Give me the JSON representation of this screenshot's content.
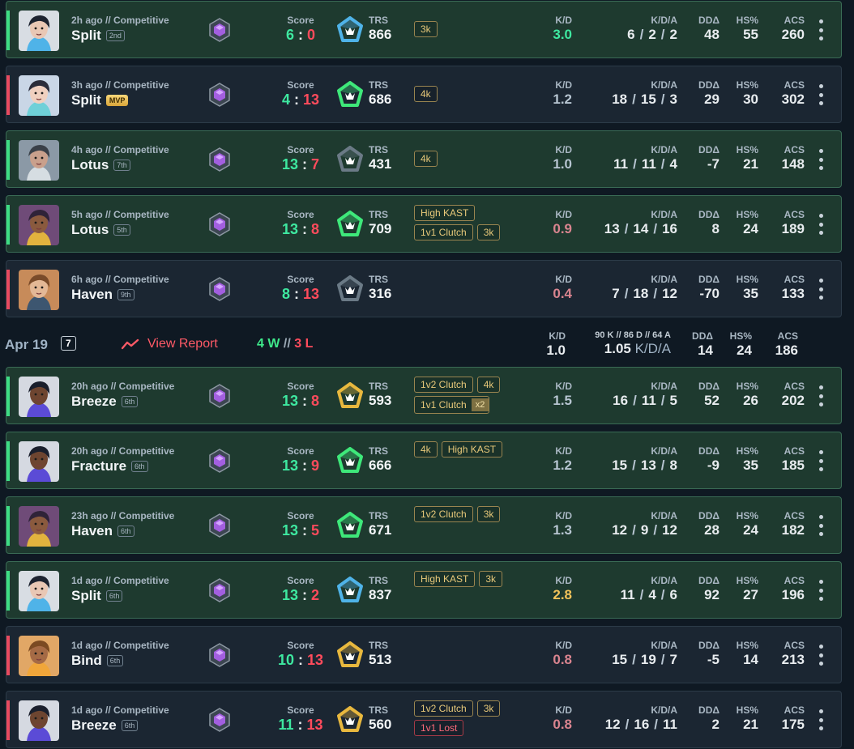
{
  "colors": {
    "win_accent": "#3ddc84",
    "loss_accent": "#e84a5f",
    "win_bg": "#1e3a2f",
    "loss_bg": "#1b2632",
    "page_bg": "#0f1923"
  },
  "labels": {
    "score": "Score",
    "trs": "TRS",
    "kd": "K/D",
    "kda": "K/D/A",
    "dd": "DDΔ",
    "hs": "HS%",
    "acs": "ACS",
    "colon": ":",
    "slash": "/"
  },
  "matches": [
    {
      "result": "win",
      "ago": "2h ago // Competitive",
      "map": "Split",
      "place": "2nd",
      "mvp": false,
      "score_team": "6",
      "score_enemy": "0",
      "trs": "866",
      "trs_color": "#4fb3e8",
      "badges": [
        "3k"
      ],
      "badge_style": [
        "gold"
      ],
      "kd": "3.0",
      "kd_tone": "green",
      "k": "6",
      "d": "2",
      "a": "2",
      "dd": "48",
      "hs": "55",
      "acs": "260",
      "agent": "jett"
    },
    {
      "result": "loss",
      "ago": "3h ago // Competitive",
      "map": "Split",
      "place": "MVP",
      "mvp": true,
      "score_team": "4",
      "score_enemy": "13",
      "trs": "686",
      "trs_color": "#3ee87a",
      "badges": [
        "4k"
      ],
      "badge_style": [
        "gold"
      ],
      "kd": "1.2",
      "kd_tone": "dim",
      "k": "18",
      "d": "15",
      "a": "3",
      "dd": "29",
      "hs": "30",
      "acs": "302",
      "agent": "sage"
    },
    {
      "result": "win",
      "ago": "4h ago // Competitive",
      "map": "Lotus",
      "place": "7th",
      "mvp": false,
      "score_team": "13",
      "score_enemy": "7",
      "trs": "431",
      "trs_color": "#6b7a86",
      "badges": [
        "4k"
      ],
      "badge_style": [
        "gold"
      ],
      "kd": "1.0",
      "kd_tone": "dim",
      "k": "11",
      "d": "11",
      "a": "4",
      "dd": "-7",
      "hs": "21",
      "acs": "148",
      "agent": "cypher"
    },
    {
      "result": "win",
      "ago": "5h ago // Competitive",
      "map": "Lotus",
      "place": "5th",
      "mvp": false,
      "score_team": "13",
      "score_enemy": "8",
      "trs": "709",
      "trs_color": "#3ee87a",
      "badges": [
        "High KAST",
        "1v1 Clutch",
        "3k"
      ],
      "badge_style": [
        "gold",
        "gold",
        "gold"
      ],
      "kd": "0.9",
      "kd_tone": "pink",
      "k": "13",
      "d": "14",
      "a": "16",
      "dd": "8",
      "hs": "24",
      "acs": "189",
      "agent": "astra"
    },
    {
      "result": "loss",
      "ago": "6h ago // Competitive",
      "map": "Haven",
      "place": "9th",
      "mvp": false,
      "score_team": "8",
      "score_enemy": "13",
      "trs": "316",
      "trs_color": "#6b7a86",
      "badges": [],
      "badge_style": [],
      "kd": "0.4",
      "kd_tone": "pink",
      "k": "7",
      "d": "18",
      "a": "12",
      "dd": "-70",
      "hs": "35",
      "acs": "133",
      "agent": "sova"
    },
    {
      "result": "win",
      "ago": "20h ago // Competitive",
      "map": "Breeze",
      "place": "6th",
      "mvp": false,
      "score_team": "13",
      "score_enemy": "8",
      "trs": "593",
      "trs_color": "#e8b83e",
      "badges": [
        "1v2 Clutch",
        "4k",
        "1v1 Clutch"
      ],
      "badge_style": [
        "gold",
        "gold",
        "gold"
      ],
      "badge_x2": "x2",
      "kd": "1.5",
      "kd_tone": "dim",
      "k": "16",
      "d": "11",
      "a": "5",
      "dd": "52",
      "hs": "26",
      "acs": "202",
      "agent": "neon"
    },
    {
      "result": "win",
      "ago": "20h ago // Competitive",
      "map": "Fracture",
      "place": "6th",
      "mvp": false,
      "score_team": "13",
      "score_enemy": "9",
      "trs": "666",
      "trs_color": "#3ee87a",
      "badges": [
        "4k",
        "High KAST"
      ],
      "badge_style": [
        "gold",
        "gold"
      ],
      "kd": "1.2",
      "kd_tone": "dim",
      "k": "15",
      "d": "13",
      "a": "8",
      "dd": "-9",
      "hs": "35",
      "acs": "185",
      "agent": "neon"
    },
    {
      "result": "win",
      "ago": "23h ago // Competitive",
      "map": "Haven",
      "place": "6th",
      "mvp": false,
      "score_team": "13",
      "score_enemy": "5",
      "trs": "671",
      "trs_color": "#3ee87a",
      "badges": [
        "1v2 Clutch",
        "3k"
      ],
      "badge_style": [
        "gold",
        "gold"
      ],
      "kd": "1.3",
      "kd_tone": "dim",
      "k": "12",
      "d": "9",
      "a": "12",
      "dd": "28",
      "hs": "24",
      "acs": "182",
      "agent": "astra"
    },
    {
      "result": "win",
      "ago": "1d ago // Competitive",
      "map": "Split",
      "place": "6th",
      "mvp": false,
      "score_team": "13",
      "score_enemy": "2",
      "trs": "837",
      "trs_color": "#4fb3e8",
      "badges": [
        "High KAST",
        "3k"
      ],
      "badge_style": [
        "gold",
        "gold"
      ],
      "kd": "2.8",
      "kd_tone": "gold",
      "k": "11",
      "d": "4",
      "a": "6",
      "dd": "92",
      "hs": "27",
      "acs": "196",
      "agent": "jett"
    },
    {
      "result": "loss",
      "ago": "1d ago // Competitive",
      "map": "Bind",
      "place": "6th",
      "mvp": false,
      "score_team": "10",
      "score_enemy": "13",
      "trs": "513",
      "trs_color": "#e8b83e",
      "badges": [],
      "badge_style": [],
      "kd": "0.8",
      "kd_tone": "pink",
      "k": "15",
      "d": "19",
      "a": "7",
      "dd": "-5",
      "hs": "14",
      "acs": "213",
      "agent": "raze"
    },
    {
      "result": "loss",
      "ago": "1d ago // Competitive",
      "map": "Breeze",
      "place": "6th",
      "mvp": false,
      "score_team": "11",
      "score_enemy": "13",
      "trs": "560",
      "trs_color": "#e8b83e",
      "badges": [
        "1v2 Clutch",
        "3k",
        "1v1 Lost"
      ],
      "badge_style": [
        "gold",
        "gold",
        "red"
      ],
      "kd": "0.8",
      "kd_tone": "pink",
      "k": "12",
      "d": "16",
      "a": "11",
      "dd": "2",
      "hs": "21",
      "acs": "175",
      "agent": "neon"
    }
  ],
  "day_summary": {
    "date": "Apr 19",
    "count": "7",
    "report_label": "View Report",
    "wins": "4 W",
    "sep": "//",
    "losses": "3 L",
    "kd": "1.0",
    "kda_detail": "90 K // 86 D // 64 A",
    "kda_value": "1.05",
    "kda_unit": "K/D/A",
    "dd": "14",
    "hs": "24",
    "acs": "186"
  }
}
